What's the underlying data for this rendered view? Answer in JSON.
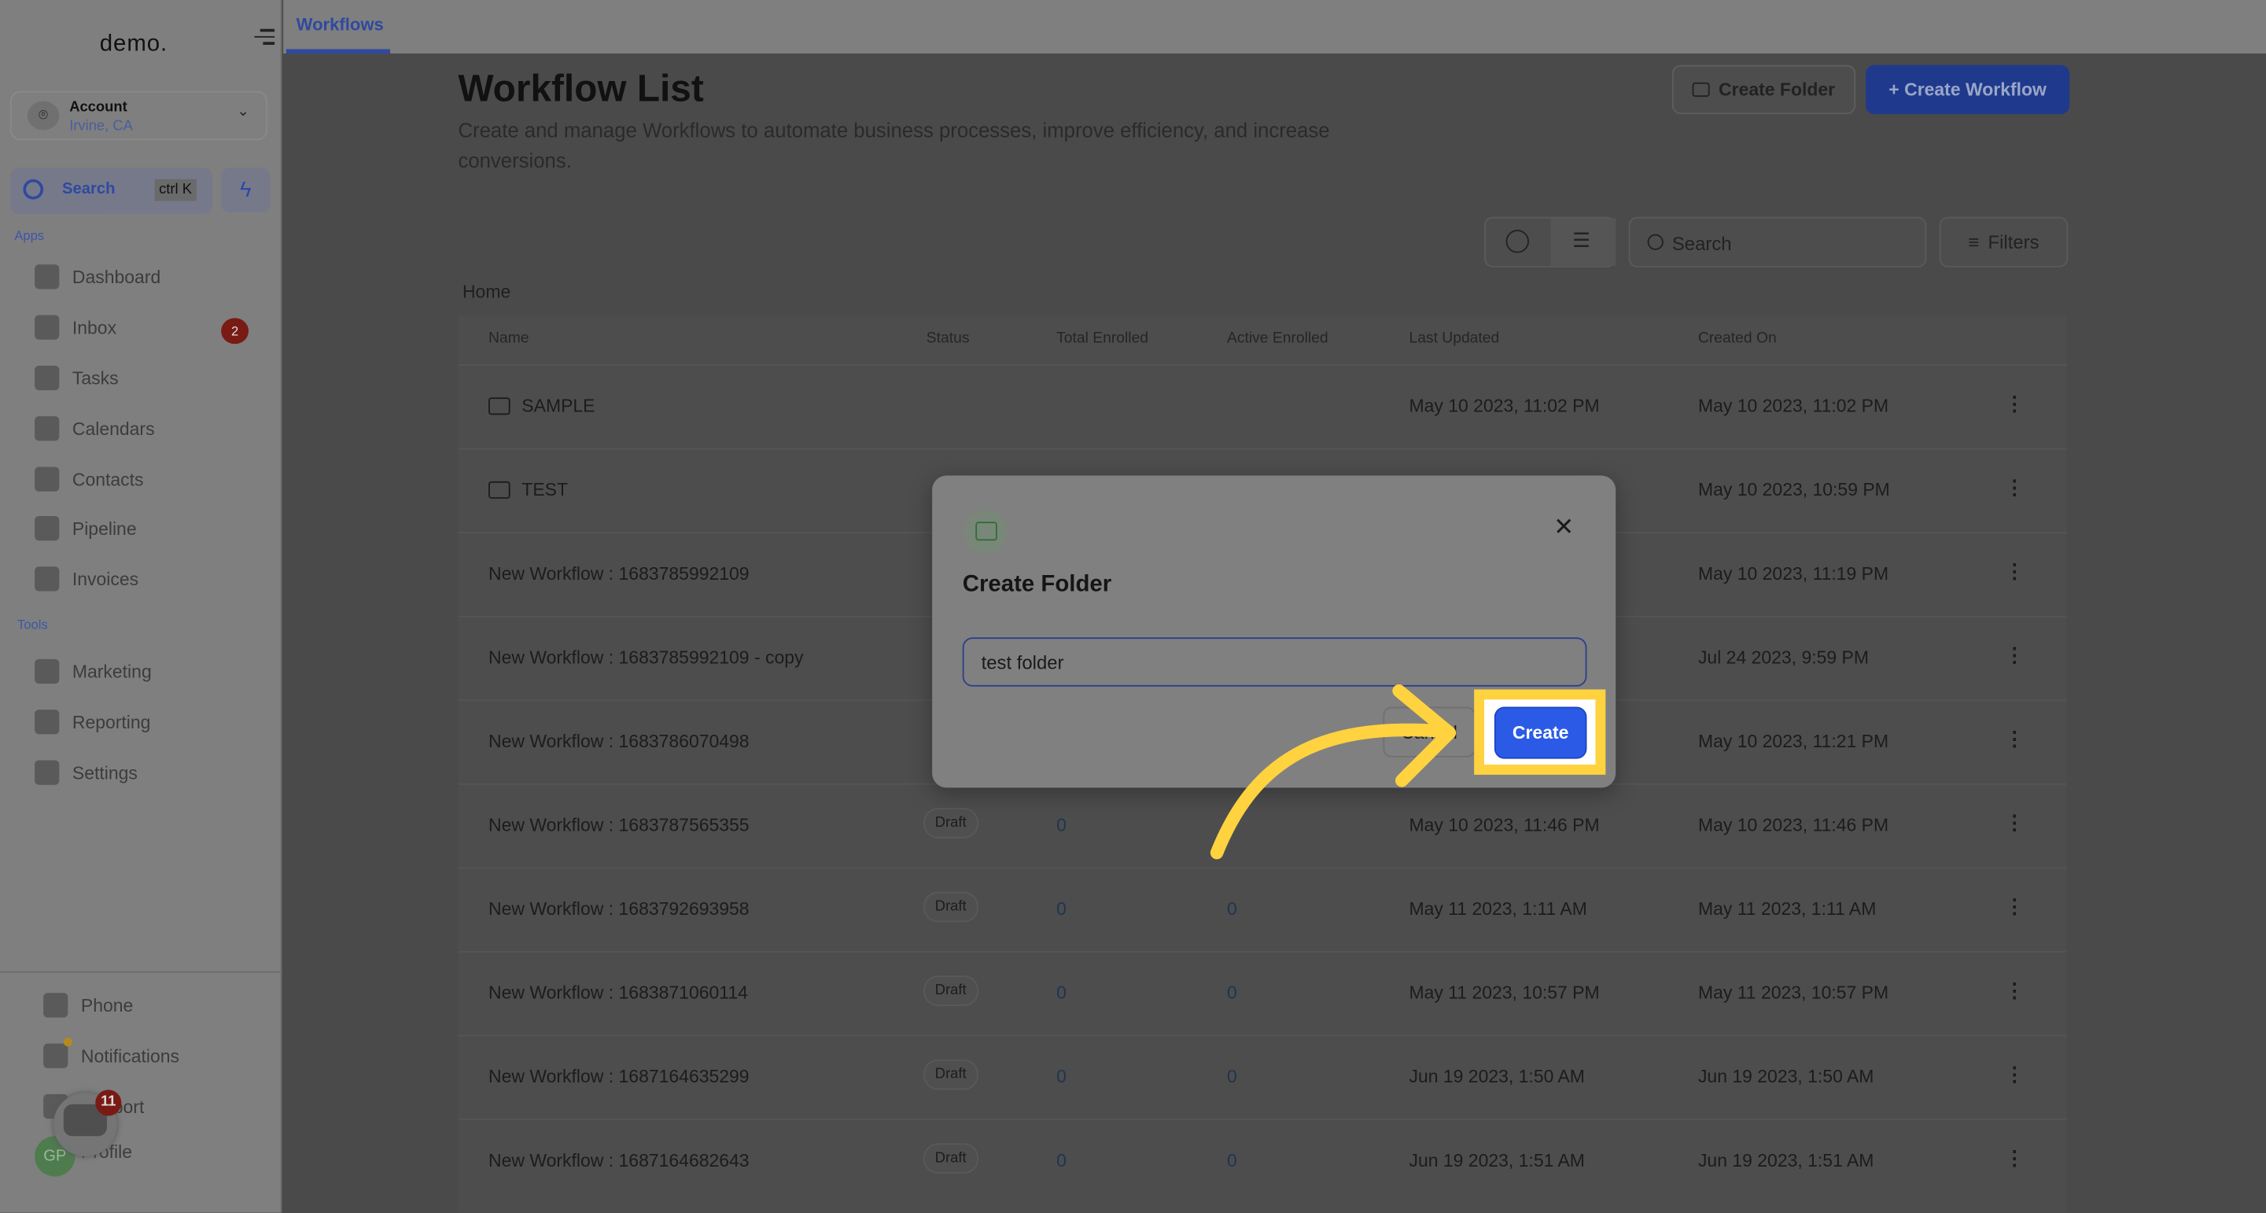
{
  "sidebar": {
    "logo": "demo.",
    "account": {
      "name": "Account",
      "location": "Irvine, CA"
    },
    "search": {
      "label": "Search",
      "shortcut": "ctrl K"
    },
    "apps_label": "Apps",
    "apps": [
      {
        "label": "Dashboard",
        "icon": "dashboard-icon"
      },
      {
        "label": "Inbox",
        "icon": "inbox-icon",
        "badge": "2"
      },
      {
        "label": "Tasks",
        "icon": "tasks-icon"
      },
      {
        "label": "Calendars",
        "icon": "calendar-icon"
      },
      {
        "label": "Contacts",
        "icon": "contacts-icon"
      },
      {
        "label": "Pipeline",
        "icon": "pipeline-icon"
      },
      {
        "label": "Invoices",
        "icon": "invoices-icon"
      }
    ],
    "tools_label": "Tools",
    "tools": [
      {
        "label": "Marketing",
        "icon": "megaphone-icon"
      },
      {
        "label": "Reporting",
        "icon": "pie-chart-icon"
      },
      {
        "label": "Settings",
        "icon": "gear-icon"
      }
    ],
    "bottom": [
      {
        "label": "Phone",
        "icon": "phone-icon"
      },
      {
        "label": "Notifications",
        "icon": "bell-icon"
      },
      {
        "label": "Support",
        "icon": "support-icon"
      },
      {
        "label": "Profile",
        "icon": "avatar"
      }
    ],
    "avatar_initials": "GP",
    "chat_badge": "11"
  },
  "topbar": {
    "tab": "Workflows"
  },
  "page": {
    "title": "Workflow List",
    "subtitle": "Create and manage Workflows to automate business processes, improve efficiency, and increase conversions.",
    "create_folder": "Create Folder",
    "create_workflow": "+ Create Workflow",
    "search_placeholder": "Search",
    "filters": "Filters",
    "breadcrumb": "Home"
  },
  "table": {
    "columns": [
      "Name",
      "Status",
      "Total Enrolled",
      "Active Enrolled",
      "Last Updated",
      "Created On"
    ],
    "rows": [
      {
        "name": "SAMPLE",
        "folder": true,
        "status": "",
        "total": "",
        "active": "",
        "updated": "May 10 2023, 11:02 PM",
        "created": "May 10 2023, 11:02 PM"
      },
      {
        "name": "TEST",
        "folder": true,
        "status": "",
        "total": "",
        "active": "",
        "updated": "",
        "created": "May 10 2023, 10:59 PM"
      },
      {
        "name": "New Workflow : 1683785992109",
        "status": "",
        "total": "",
        "active": "",
        "updated": "",
        "created": "May 10 2023, 11:19 PM"
      },
      {
        "name": "New Workflow : 1683785992109 - copy",
        "status": "",
        "total": "",
        "active": "",
        "updated": "",
        "created": "Jul 24 2023, 9:59 PM"
      },
      {
        "name": "New Workflow : 1683786070498",
        "status": "",
        "total": "",
        "active": "",
        "updated": "",
        "created": "May 10 2023, 11:21 PM"
      },
      {
        "name": "New Workflow : 1683787565355",
        "status": "Draft",
        "total": "0",
        "active": "",
        "updated": "May 10 2023, 11:46 PM",
        "created": "May 10 2023, 11:46 PM"
      },
      {
        "name": "New Workflow : 1683792693958",
        "status": "Draft",
        "total": "0",
        "active": "0",
        "updated": "May 11 2023, 1:11 AM",
        "created": "May 11 2023, 1:11 AM"
      },
      {
        "name": "New Workflow : 1683871060114",
        "status": "Draft",
        "total": "0",
        "active": "0",
        "updated": "May 11 2023, 10:57 PM",
        "created": "May 11 2023, 10:57 PM"
      },
      {
        "name": "New Workflow : 1687164635299",
        "status": "Draft",
        "total": "0",
        "active": "0",
        "updated": "Jun 19 2023, 1:50 AM",
        "created": "Jun 19 2023, 1:50 AM"
      },
      {
        "name": "New Workflow : 1687164682643",
        "status": "Draft",
        "total": "0",
        "active": "0",
        "updated": "Jun 19 2023, 1:51 AM",
        "created": "Jun 19 2023, 1:51 AM"
      }
    ]
  },
  "modal": {
    "title": "Create Folder",
    "input_value": "test folder",
    "cancel": "Cancel",
    "create": "Create"
  },
  "colors": {
    "accent": "#2b5be6",
    "highlight": "#ffd23f",
    "folder_icon": "#2f6e35"
  }
}
